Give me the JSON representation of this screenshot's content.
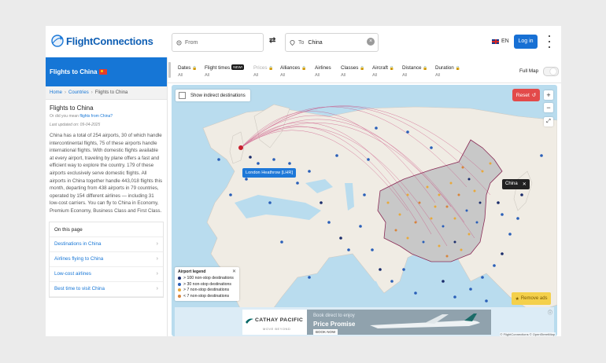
{
  "header": {
    "logo": "FlightConnections",
    "from_placeholder": "From",
    "to_label": "To",
    "to_value": "China",
    "language": "EN",
    "login": "Log in"
  },
  "sidebar": {
    "title": "Flights to China",
    "breadcrumb": [
      "Home",
      "Countries",
      "Flights to China"
    ],
    "heading": "Flights to China",
    "subline_prefix": "Or did you mean",
    "subline_link": "flights from China?",
    "updated": "Last updated on: 09-04-2025",
    "paragraph": "China has a total of 254 airports, 30 of which handle intercontinental flights, 75 of these airports handle international flights. With domestic flights available at every airport, traveling by plane offers a fast and efficient way to explore the country. 179 of these airports exclusively serve domestic flights. All airports in China together handle 443,018 flights this month, departing from 438 airports in 79 countries, operated by 154 different airlines — including 31 low-cost carriers. You can fly to China in Economy, Premium Economy, Business Class and First Class.",
    "on_this_page": "On this page",
    "items": [
      "Destinations in China",
      "Airlines flying to China",
      "Low-cost airlines",
      "Best time to visit China"
    ]
  },
  "filters": {
    "items": [
      {
        "label": "Dates",
        "value": "All",
        "locked": true,
        "dim": false
      },
      {
        "label": "Flight times",
        "value": "All",
        "badge": "NEW!",
        "dim": false
      },
      {
        "label": "Prices",
        "value": "All",
        "locked": true,
        "dim": true
      },
      {
        "label": "Alliances",
        "value": "All",
        "locked": true,
        "dim": false
      },
      {
        "label": "Airlines",
        "value": "All",
        "dim": false
      },
      {
        "label": "Classes",
        "value": "All",
        "locked": true,
        "dim": false
      },
      {
        "label": "Aircraft",
        "value": "All",
        "locked": true,
        "dim": false
      },
      {
        "label": "Distance",
        "value": "All",
        "locked": true,
        "dim": false
      },
      {
        "label": "Duration",
        "value": "All",
        "locked": true,
        "dim": false
      }
    ],
    "full_map": "Full Map"
  },
  "map": {
    "indirect": "Show indirect destinations",
    "reset": "Reset",
    "zoom_in": "+",
    "zoom_out": "−",
    "origin_tag": "London Heathrow [LHR]",
    "destination_tag": "China",
    "legend": {
      "title": "Airport legend",
      "rows": [
        {
          "label": "> 100 non-stop destinations",
          "color": "#1a2c6b"
        },
        {
          "label": "> 30 non-stop destinations",
          "color": "#2a5fb8"
        },
        {
          "label": "> 7 non-stop destinations",
          "color": "#e8a93a"
        },
        {
          "label": "< 7 non-stop destinations",
          "color": "#d8843a"
        }
      ]
    },
    "remove_ads": "Remove ads",
    "attribution": "© FlightConnections © OpenStreetMap"
  },
  "ad": {
    "brand": "CATHAY PACIFIC",
    "brand_sub": "MOVE BEYOND",
    "line1": "Book direct to enjoy",
    "line2": "Price Promise",
    "cta": "BOOK NOW"
  },
  "colors": {
    "brand_blue": "#1676d6",
    "reset_red": "#e34a4a",
    "route_line": "#c8467a",
    "china_fill": "#c8c8c8"
  }
}
